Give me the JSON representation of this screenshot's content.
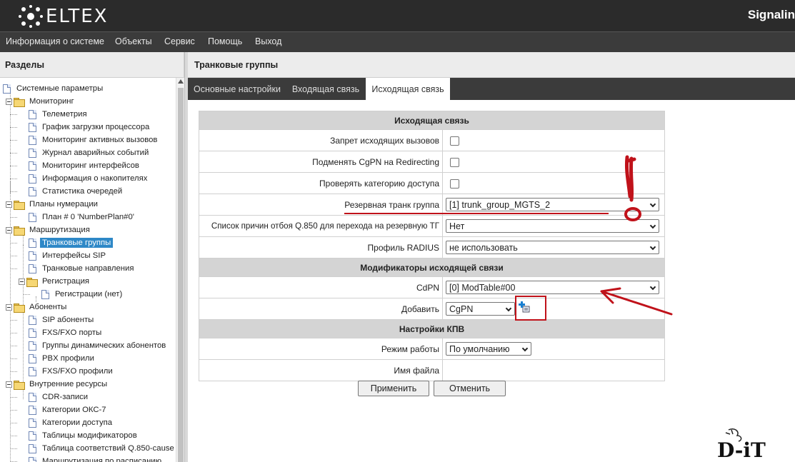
{
  "header": {
    "brand": "ELTEX",
    "product": "Signalin"
  },
  "menu": {
    "items": [
      "Информация о системе",
      "Объекты",
      "Сервис",
      "Помощь",
      "Выход"
    ]
  },
  "sidebar": {
    "title": "Разделы",
    "tree": [
      {
        "label": "Системные параметры"
      },
      {
        "label": "Мониторинг"
      },
      {
        "label": "Телеметрия"
      },
      {
        "label": "График загрузки процессора"
      },
      {
        "label": "Мониторинг активных вызовов"
      },
      {
        "label": "Журнал аварийных событий"
      },
      {
        "label": "Мониторинг интерфейсов"
      },
      {
        "label": "Информация о накопителях"
      },
      {
        "label": "Статистика очередей"
      },
      {
        "label": "Планы нумерации"
      },
      {
        "label": "План # 0 'NumberPlan#0'"
      },
      {
        "label": "Маршрутизация"
      },
      {
        "label": "Транковые группы"
      },
      {
        "label": "Интерфейсы SIP"
      },
      {
        "label": "Транковые направления"
      },
      {
        "label": "Регистрация"
      },
      {
        "label": "Регистрации (нет)"
      },
      {
        "label": "Абоненты"
      },
      {
        "label": "SIP абоненты"
      },
      {
        "label": "FXS/FXO порты"
      },
      {
        "label": "Группы динамических абонентов"
      },
      {
        "label": "PBX профили"
      },
      {
        "label": "FXS/FXO профили"
      },
      {
        "label": "Внутренние ресурсы"
      },
      {
        "label": "CDR-записи"
      },
      {
        "label": "Категории ОКС-7"
      },
      {
        "label": "Категории доступа"
      },
      {
        "label": "Таблицы модификаторов"
      },
      {
        "label": "Таблица соответствий Q.850-cause"
      },
      {
        "label": "Маршрутизация по расписанию"
      }
    ],
    "selected": "Транковые группы"
  },
  "main": {
    "title": "Транковые группы",
    "tabs": [
      "Основные настройки",
      "Входящая связь",
      "Исходящая связь"
    ],
    "active_tab": "Исходящая связь",
    "form": {
      "section1": "Исходящая связь",
      "deny_outgoing_label": "Запрет исходящих вызовов",
      "replace_cgpn_label": "Подменять CgPN на Redirecting",
      "check_category_label": "Проверять категорию доступа",
      "reserve_group_label": "Резервная транк группа",
      "reserve_group_value": "[1] trunk_group_MGTS_2",
      "causes_label": "Список причин отбоя Q.850 для перехода на резервную ТГ",
      "causes_value": "Нет",
      "radius_label": "Профиль RADIUS",
      "radius_value": "не использовать",
      "section2": "Модификаторы исходящей связи",
      "cdpn_label": "CdPN",
      "cdpn_value": "[0] ModTable#00",
      "add_label": "Добавить",
      "add_value": "CgPN",
      "section3": "Настройки КПВ",
      "mode_label": "Режим работы",
      "mode_value": "По умолчанию",
      "filename_label": "Имя файла",
      "filename_value": ""
    },
    "apply_label": "Применить",
    "cancel_label": "Отменить"
  },
  "watermark": "D-iT",
  "colors": {
    "header_bg": "#2b2b2b",
    "menu_bg": "#3b3b3b",
    "selected_bg": "#2e88c7",
    "annotation": "#c0121a"
  }
}
